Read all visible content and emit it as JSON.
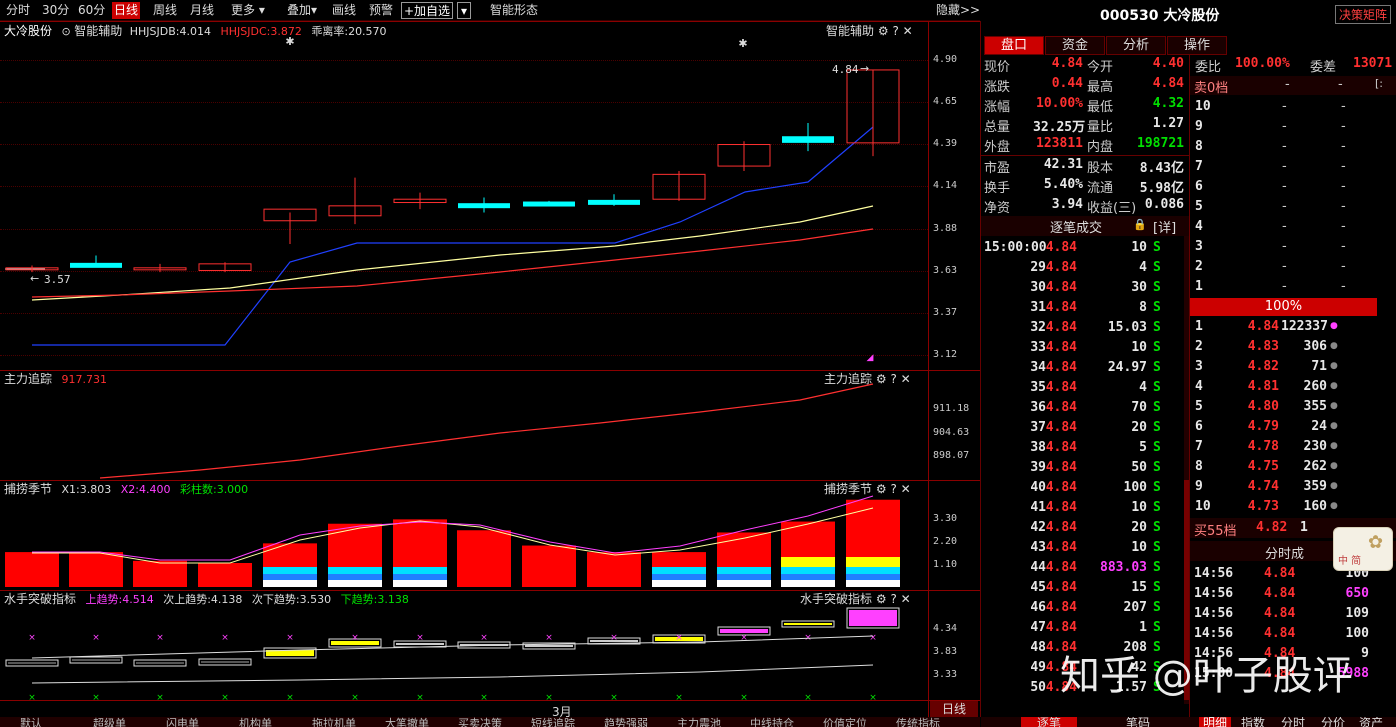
{
  "toolbar": {
    "items": [
      "分时",
      "30分",
      "60分",
      "日线",
      "周线",
      "月线",
      "更多",
      "叠加",
      "画线",
      "预警"
    ],
    "selected": "日线",
    "add_watch": "+加自选",
    "smart_shape": "智能形态",
    "hide": "隐藏>>"
  },
  "main_panel": {
    "stock_name": "大冷股份",
    "assist": "智能辅助",
    "hhjsjdb": "HHJSJDB:4.014",
    "hhjsjdc": "HHJSJDC:3.872",
    "deviation": "乖离率:20.570",
    "label_right": "智能辅助",
    "last_price_label": "4.84",
    "low_price_label": "3.57",
    "yticks": [
      "4.90",
      "4.65",
      "4.39",
      "4.14",
      "3.88",
      "3.63",
      "3.37",
      "3.12"
    ]
  },
  "tracking_panel": {
    "title": "主力追踪",
    "value": "917.731",
    "label_right": "主力追踪",
    "yticks": [
      "911.18",
      "904.63",
      "898.07"
    ]
  },
  "season_panel": {
    "title": "捕捞季节",
    "x1": "X1:3.803",
    "x2": "X2:4.400",
    "bars": "彩柱数:3.000",
    "label_right": "捕捞季节",
    "yticks": [
      "3.30",
      "2.20",
      "1.10"
    ]
  },
  "sailor_panel": {
    "title": "水手突破指标",
    "up_trend": "上趋势:4.514",
    "next_up": "次上趋势:4.138",
    "next_down": "次下趋势:3.530",
    "down_trend": "下趋势:3.138",
    "label_right": "水手突破指标",
    "yticks": [
      "4.34",
      "3.83",
      "3.33"
    ]
  },
  "month_label": "3月",
  "period_label": "日线",
  "bottom_tabs": [
    "默认",
    "超级单",
    "闪电单",
    "机构单",
    "拖拉机单",
    "大笔撤单",
    "买卖决策",
    "短线追踪",
    "趋势强弱",
    "主力震池",
    "中线持仓",
    "价值定位",
    "传统指标"
  ],
  "chart_data": {
    "type": "candlestick",
    "candles": [
      {
        "o": 3.64,
        "h": 3.66,
        "l": 3.62,
        "c": 3.64
      },
      {
        "o": 3.67,
        "h": 3.72,
        "l": 3.66,
        "c": 3.67
      },
      {
        "o": 3.64,
        "h": 3.67,
        "l": 3.62,
        "c": 3.64
      },
      {
        "o": 3.63,
        "h": 3.68,
        "l": 3.62,
        "c": 3.67
      },
      {
        "o": 3.93,
        "h": 3.98,
        "l": 3.79,
        "c": 4.0
      },
      {
        "o": 3.96,
        "h": 4.19,
        "l": 3.91,
        "c": 4.02
      },
      {
        "o": 4.06,
        "h": 4.1,
        "l": 4.0,
        "c": 4.04
      },
      {
        "o": 4.03,
        "h": 4.07,
        "l": 3.98,
        "c": 4.03
      },
      {
        "o": 4.04,
        "h": 4.05,
        "l": 4.02,
        "c": 4.04
      },
      {
        "o": 4.05,
        "h": 4.09,
        "l": 4.02,
        "c": 4.05
      },
      {
        "o": 4.06,
        "h": 4.23,
        "l": 4.05,
        "c": 4.21
      },
      {
        "o": 4.26,
        "h": 4.41,
        "l": 4.23,
        "c": 4.39
      },
      {
        "o": 4.44,
        "h": 4.52,
        "l": 4.35,
        "c": 4.4
      },
      {
        "o": 4.4,
        "h": 4.84,
        "l": 4.32,
        "c": 4.84
      }
    ],
    "up_color": "#ff3030",
    "down_color": "#00ffff"
  },
  "right": {
    "code_name": "000530 大冷股份",
    "decision": "决策矩阵",
    "tabs": [
      "盘口",
      "资金",
      "分析",
      "操作"
    ],
    "quote": [
      [
        "现价",
        "4.84",
        "今开",
        "4.40"
      ],
      [
        "涨跌",
        "0.44",
        "最高",
        "4.84"
      ],
      [
        "涨幅",
        "10.00%",
        "最低",
        "4.32"
      ],
      [
        "总量",
        "32.25万",
        "量比",
        "1.27"
      ],
      [
        "外盘",
        "123811",
        "内盘",
        "198721"
      ]
    ],
    "fund": [
      [
        "市盈",
        "42.31",
        "股本",
        "8.43亿"
      ],
      [
        "换手",
        "5.40%",
        "流通",
        "5.98亿"
      ],
      [
        "净资",
        "3.94",
        "收益(三)",
        "0.086"
      ]
    ],
    "deal_title": "逐笔成交",
    "deal_detail": "[详]",
    "ticks": [
      [
        "15:00:00",
        "4.84",
        "10",
        "S"
      ],
      [
        "29",
        "4.84",
        "4",
        "S"
      ],
      [
        "30",
        "4.84",
        "30",
        "S"
      ],
      [
        "31",
        "4.84",
        "8",
        "S"
      ],
      [
        "32",
        "4.84",
        "15.03",
        "S"
      ],
      [
        "33",
        "4.84",
        "10",
        "S"
      ],
      [
        "34",
        "4.84",
        "24.97",
        "S"
      ],
      [
        "35",
        "4.84",
        "4",
        "S"
      ],
      [
        "36",
        "4.84",
        "70",
        "S"
      ],
      [
        "37",
        "4.84",
        "20",
        "S"
      ],
      [
        "38",
        "4.84",
        "5",
        "S"
      ],
      [
        "39",
        "4.84",
        "50",
        "S"
      ],
      [
        "40",
        "4.84",
        "100",
        "S"
      ],
      [
        "41",
        "4.84",
        "10",
        "S"
      ],
      [
        "42",
        "4.84",
        "20",
        "S"
      ],
      [
        "43",
        "4.84",
        "10",
        "S"
      ],
      [
        "44",
        "4.84",
        "883.03",
        "S"
      ],
      [
        "45",
        "4.84",
        "15",
        "S"
      ],
      [
        "46",
        "4.84",
        "207",
        "S"
      ],
      [
        "47",
        "4.84",
        "1",
        "S"
      ],
      [
        "48",
        "4.84",
        "208",
        "S"
      ],
      [
        "49",
        "4.84",
        "42",
        "S"
      ],
      [
        "50",
        "4.84",
        "1.57",
        "S"
      ]
    ],
    "ratio_label": "委比",
    "ratio": "100.00%",
    "diff_label": "委差",
    "diff": "13071",
    "sell0": "卖0档",
    "sell_levels": [
      "10",
      "9",
      "8",
      "7",
      "6",
      "5",
      "4",
      "3",
      "2",
      "1"
    ],
    "pct_bar": "100%",
    "buy_levels": [
      [
        "1",
        "4.84",
        "122337"
      ],
      [
        "2",
        "4.83",
        "306"
      ],
      [
        "3",
        "4.82",
        "71"
      ],
      [
        "4",
        "4.81",
        "260"
      ],
      [
        "5",
        "4.80",
        "355"
      ],
      [
        "6",
        "4.79",
        "24"
      ],
      [
        "7",
        "4.78",
        "230"
      ],
      [
        "8",
        "4.75",
        "262"
      ],
      [
        "9",
        "4.74",
        "359"
      ],
      [
        "10",
        "4.73",
        "160"
      ]
    ],
    "buy55": "买55档",
    "buy55_price": "4.82",
    "buy55_vol": "1",
    "time_deal": "分时成",
    "time_rows": [
      [
        "14:56",
        "4.84",
        "100"
      ],
      [
        "14:56",
        "4.84",
        "650"
      ],
      [
        "14:56",
        "4.84",
        "109"
      ],
      [
        "14:56",
        "4.84",
        "100"
      ],
      [
        "14:56",
        "4.84",
        "9"
      ],
      [
        "15:00",
        "4.84",
        "5988"
      ]
    ],
    "bottom_tabs": [
      "逐笔",
      "笔码",
      "明细",
      "指数",
      "分时",
      "分价",
      "资产"
    ],
    "watermark": "知乎 @叶子股评"
  }
}
